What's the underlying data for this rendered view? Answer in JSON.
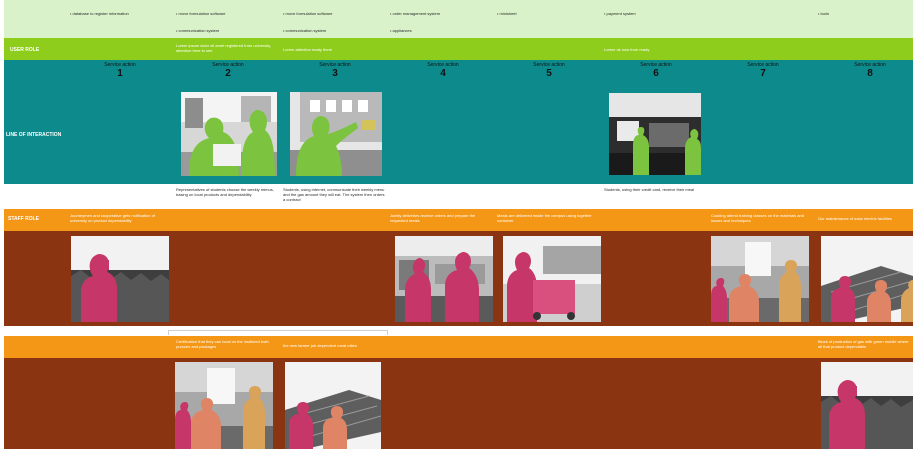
{
  "top_row": [
    "• database to register information",
    "• move formulation software",
    "• communication system",
    "• move formulation software",
    "• communication system",
    "• order management system",
    "• appliances",
    "• minisheet",
    "• payment system",
    "• tools"
  ],
  "green_band": {
    "label": "USER ROLE",
    "notes": [
      "Lorem ipsum dolor sit amet registered from university, attention here to see",
      "Lorem attention ready there",
      "Lorem ok now from ready"
    ]
  },
  "teal_band": {
    "label": "LINE OF INTERACTION",
    "service_action_label": "Service action",
    "numbers": [
      "1",
      "2",
      "3",
      "4",
      "5",
      "6",
      "7",
      "8"
    ]
  },
  "white_notes": [
    "Representatives of students choose the weekly menus, basing on local products and dependability",
    "Students, using internet, communicate their weekly menu and the gas amount they will eat. The system then orders a contract",
    "Students, using their credit card, receive their meal"
  ],
  "orange_band": {
    "label": "STAFF ROLE",
    "notes": [
      "Journeymen and cooperative gets notification of university on product dependability",
      "Jointly deliveries receive orders and prepare the requested meals",
      "Meals are delivered inside the campus using together container",
      "Cooking attend training classes on the materials and issues and techniques",
      "Our maintenance of solar electric facilities"
    ]
  },
  "bottom_orange": {
    "notes": [
      "Certification that they can local on the instituted both pursues and packages",
      "the new farmer job dependent meat mites",
      "Block of production of gas with green mobile where all that product dependable"
    ]
  },
  "colors": {
    "pale_green": "#d9f2c9",
    "lime": "#8ecd1b",
    "teal": "#0d8a8c",
    "orange": "#f49716",
    "brown": "#8a3412",
    "figure_green": "#7cc33f",
    "figure_magenta": "#c63668",
    "figure_salmon": "#e08466",
    "figure_tan": "#d9a35a"
  }
}
